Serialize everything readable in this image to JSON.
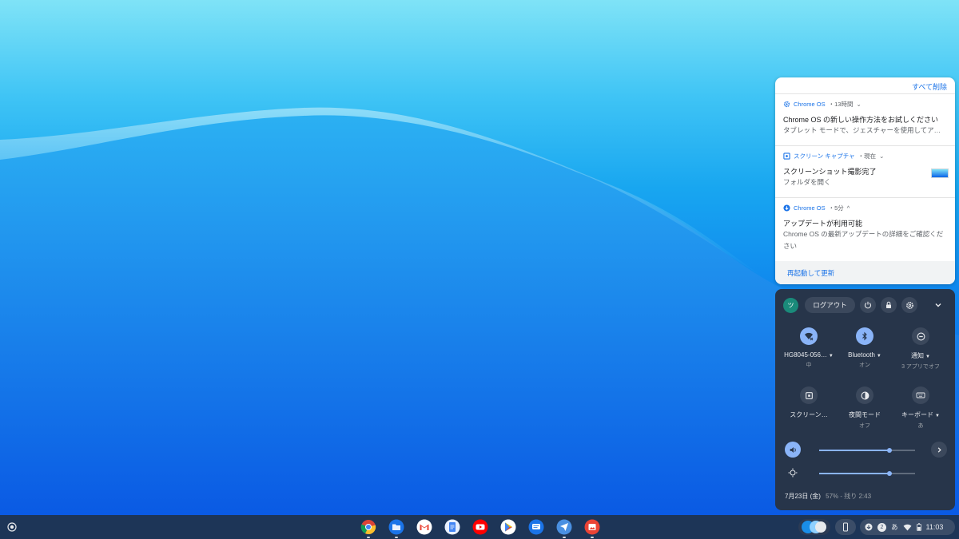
{
  "notifications": {
    "clear_all": "すべて削除",
    "items": [
      {
        "app": "Chrome OS",
        "meta": "・13時間",
        "expand": "⌄",
        "title": "Chrome OS の新しい操作方法をお試しください",
        "body": "タブレット モードで、ジェスチャーを使用してア…",
        "icon": "gear-icon"
      },
      {
        "app": "スクリーン キャプチャ",
        "meta": "・現在",
        "expand": "⌄",
        "title": "スクリーンショット撮影完了",
        "body": "フォルダを開く",
        "icon": "screenshot-icon"
      },
      {
        "app": "Chrome OS",
        "meta": "・5分",
        "expand": "^",
        "title": "アップデートが利用可能",
        "body": "Chrome OS の最新アップデートの詳細をご確認ください",
        "icon": "update-icon"
      }
    ],
    "action": "再起動して更新"
  },
  "quick_settings": {
    "avatar": "ツ",
    "logout_label": "ログアウト",
    "tiles": [
      {
        "label": "HG8045-056…",
        "sub": "中",
        "icon": "wifi-icon",
        "active": true
      },
      {
        "label": "Bluetooth",
        "sub": "オン",
        "icon": "bluetooth-icon",
        "active": true
      },
      {
        "label": "通知",
        "sub": "3 アプリでオフ",
        "icon": "do-not-disturb-icon",
        "active": false
      },
      {
        "label": "スクリーン…",
        "sub": "",
        "icon": "screen-capture-icon",
        "active": false
      },
      {
        "label": "夜間モード",
        "sub": "オフ",
        "icon": "night-light-icon",
        "active": false
      },
      {
        "label": "キーボード",
        "sub": "あ",
        "icon": "keyboard-icon",
        "active": false
      }
    ],
    "volume_level": 0.73,
    "brightness_level": 0.73,
    "date": "7月23日 (金)",
    "battery": "57% - 残り 2:43"
  },
  "shelf": {
    "apps": [
      "chrome-icon",
      "files-icon",
      "gmail-icon",
      "docs-icon",
      "youtube-icon",
      "play-store-icon",
      "messages-icon",
      "paper-plane-icon",
      "gallery-icon"
    ],
    "ime": "あ",
    "notification_count": "2",
    "time": "11:03"
  },
  "colors": {
    "accent": "#1a73e8",
    "qs_bg": "#27354a",
    "qs_active": "#8ab4f8",
    "shelf_bg": "#1d3557"
  }
}
